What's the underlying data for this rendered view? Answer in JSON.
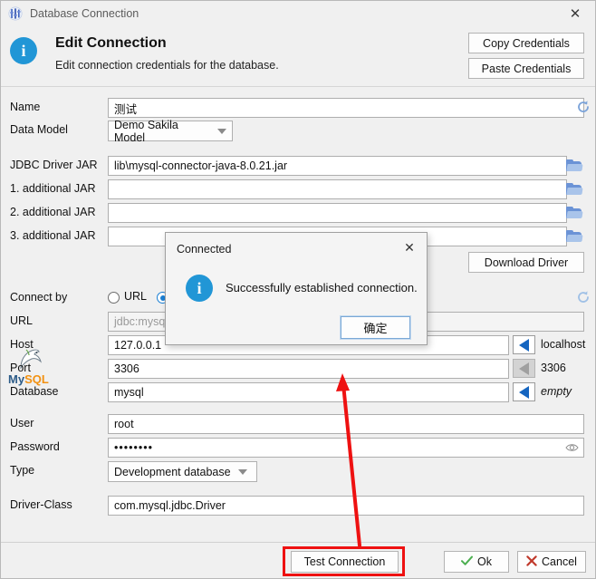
{
  "window": {
    "title": "Database Connection",
    "title_icon": "database-connection-icon",
    "close_icon": "✕"
  },
  "header": {
    "icon": "info-icon",
    "info_glyph": "i",
    "title": "Edit Connection",
    "subtitle": "Edit connection credentials for the database.",
    "copy_credentials_label": "Copy Credentials",
    "paste_credentials_label": "Paste Credentials"
  },
  "form": {
    "name": {
      "label": "Name",
      "value": "测试"
    },
    "data_model": {
      "label": "Data Model",
      "value": "Demo Sakila Model"
    },
    "jdbc_driver_jar": {
      "label": "JDBC Driver JAR",
      "value": "lib\\mysql-connector-java-8.0.21.jar"
    },
    "additional_jar_1": {
      "label": "1. additional JAR",
      "value": ""
    },
    "additional_jar_2": {
      "label": "2. additional JAR",
      "value": ""
    },
    "additional_jar_3": {
      "label": "3. additional JAR",
      "value": ""
    },
    "download_driver_label": "Download Driver",
    "connect_by": {
      "label": "Connect by",
      "option_url": "URL",
      "selected": "host"
    },
    "url": {
      "label": "URL",
      "placeholder": "jdbc:mysql:",
      "value": ""
    },
    "host": {
      "label": "Host",
      "value": "127.0.0.1",
      "hint": "localhost"
    },
    "port": {
      "label": "Port",
      "value": "3306",
      "hint": "3306"
    },
    "database": {
      "label": "Database",
      "value": "mysql",
      "hint": "empty"
    },
    "user": {
      "label": "User",
      "value": "root"
    },
    "password": {
      "label": "Password",
      "value": "••••••••"
    },
    "type": {
      "label": "Type",
      "value": "Development database"
    },
    "driver_class": {
      "label": "Driver-Class",
      "value": "com.mysql.jdbc.Driver"
    }
  },
  "mysql_logo": {
    "part1": "My",
    "part2": "SQL"
  },
  "footer": {
    "test_connection_label": "Test Connection",
    "ok_label": "Ok",
    "cancel_label": "Cancel"
  },
  "modal": {
    "title": "Connected",
    "close_icon": "✕",
    "info_glyph": "i",
    "message": "Successfully established connection.",
    "ok_label": "确定"
  },
  "colors": {
    "accent_blue": "#2196d6",
    "folder_blue": "#6b93d6",
    "hint_blue": "#1565c0",
    "annotation_red": "#ee1111",
    "mysql_dark": "#2d5c88",
    "mysql_orange": "#f29111",
    "ok_green": "#4caf50",
    "cancel_red": "#c0392b"
  }
}
